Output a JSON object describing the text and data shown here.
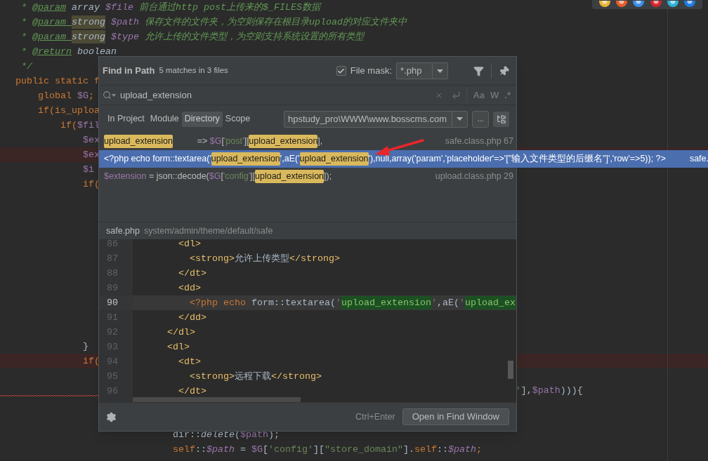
{
  "editor": {
    "lines": [
      {
        "marked": false,
        "underlined": false,
        "segments": [
          {
            "text": " * ",
            "kind": "comment"
          },
          {
            "text": "@param",
            "kind": "doc-tag"
          },
          {
            "text": " array ",
            "kind": "doc-type"
          },
          {
            "text": "$file",
            "kind": "doc-var"
          },
          {
            "text": " 前台通过http post上传来的$_FILES数据",
            "kind": "comment"
          }
        ]
      },
      {
        "marked": false,
        "underlined": false,
        "segments": [
          {
            "text": " * ",
            "kind": "comment"
          },
          {
            "text": "@param ",
            "kind": "doc-tag"
          },
          {
            "text": "strong",
            "kind": "doc-type-marked"
          },
          {
            "text": " $path",
            "kind": "doc-var"
          },
          {
            "text": " 保存文件的文件夹，为空则保存在根目录upload的对应文件夹中",
            "kind": "comment"
          }
        ]
      },
      {
        "marked": false,
        "underlined": false,
        "segments": [
          {
            "text": " * ",
            "kind": "comment"
          },
          {
            "text": "@param ",
            "kind": "doc-tag"
          },
          {
            "text": "strong",
            "kind": "doc-type-marked"
          },
          {
            "text": " $type",
            "kind": "doc-var"
          },
          {
            "text": " 允许上传的文件类型，为空则支持系统设置的所有类型",
            "kind": "comment"
          }
        ]
      },
      {
        "marked": false,
        "underlined": false,
        "segments": [
          {
            "text": " * ",
            "kind": "comment"
          },
          {
            "text": "@return",
            "kind": "doc-tag"
          },
          {
            "text": " boolean",
            "kind": "doc-type"
          }
        ]
      },
      {
        "marked": false,
        "underlined": false,
        "segments": [
          {
            "text": " */",
            "kind": "comment"
          }
        ]
      },
      {
        "marked": false,
        "underlined": false,
        "segments": [
          {
            "text": "public static f",
            "kind": "keyword"
          }
        ]
      },
      {
        "marked": false,
        "underlined": false,
        "segments": [
          {
            "text": "    global ",
            "kind": "keyword"
          },
          {
            "text": "$G",
            "kind": "var"
          },
          {
            "text": ";",
            "kind": "keyword"
          }
        ]
      },
      {
        "marked": false,
        "underlined": false,
        "segments": [
          {
            "text": "    if(is_uploa",
            "kind": "keyword"
          }
        ]
      },
      {
        "marked": false,
        "underlined": false,
        "segments": [
          {
            "text": "        if(",
            "kind": "keyword"
          },
          {
            "text": "$fil",
            "kind": "var"
          }
        ]
      },
      {
        "marked": false,
        "underlined": false,
        "segments": [
          {
            "text": "            $ex",
            "kind": "var"
          }
        ]
      },
      {
        "marked": true,
        "underlined": false,
        "segments": [
          {
            "text": "            $ex",
            "kind": "var"
          }
        ]
      },
      {
        "marked": false,
        "underlined": false,
        "segments": [
          {
            "text": "            $i",
            "kind": "var"
          }
        ]
      },
      {
        "marked": false,
        "underlined": false,
        "segments": [
          {
            "text": "            if(",
            "kind": "keyword"
          }
        ]
      },
      {
        "marked": false,
        "underlined": false
      },
      {
        "marked": false,
        "underlined": false
      },
      {
        "marked": false,
        "underlined": false
      },
      {
        "marked": false,
        "underlined": false
      },
      {
        "marked": false,
        "underlined": false
      },
      {
        "marked": false,
        "underlined": false
      },
      {
        "marked": false,
        "underlined": false
      },
      {
        "marked": false,
        "underlined": false
      },
      {
        "marked": false,
        "underlined": false
      },
      {
        "marked": false,
        "underlined": false
      },
      {
        "marked": false,
        "underlined": false,
        "segments": [
          {
            "text": "            }",
            "kind": "plain"
          }
        ]
      },
      {
        "marked": true,
        "underlined": false,
        "segments": [
          {
            "text": "            if(",
            "kind": "keyword"
          }
        ]
      },
      {
        "marked": false,
        "underlined": false
      },
      {
        "marked": false,
        "underlined": true,
        "segments": [
          {
            "text": "                                                                                         '",
            "kind": "string"
          },
          {
            "text": "],",
            "kind": "plain"
          },
          {
            "text": "$path",
            "kind": "var"
          },
          {
            "text": "))){",
            "kind": "plain"
          }
        ]
      },
      {
        "marked": false,
        "underlined": false
      },
      {
        "marked": false,
        "underlined": false
      },
      {
        "marked": false,
        "underlined": false,
        "segments": [
          {
            "text": "                            dir::",
            "kind": "plain"
          },
          {
            "text": "delete",
            "kind": "plain-italic"
          },
          {
            "text": "(",
            "kind": "plain"
          },
          {
            "text": "$path",
            "kind": "var"
          },
          {
            "text": ");",
            "kind": "plain"
          }
        ]
      },
      {
        "marked": false,
        "underlined": false,
        "segments": [
          {
            "text": "                            self",
            "kind": "keyword"
          },
          {
            "text": "::",
            "kind": "plain"
          },
          {
            "text": "$path",
            "kind": "var-italic"
          },
          {
            "text": " = ",
            "kind": "plain"
          },
          {
            "text": "$G",
            "kind": "var"
          },
          {
            "text": "[",
            "kind": "plain"
          },
          {
            "text": "'config'",
            "kind": "string"
          },
          {
            "text": "][",
            "kind": "plain"
          },
          {
            "text": "\"store_domain\"",
            "kind": "string"
          },
          {
            "text": "].",
            "kind": "plain"
          },
          {
            "text": "self",
            "kind": "keyword"
          },
          {
            "text": "::",
            "kind": "plain"
          },
          {
            "text": "$path",
            "kind": "var-italic"
          },
          {
            "text": ";",
            "kind": "keyword"
          }
        ]
      }
    ]
  },
  "find_dialog": {
    "title": "Find in Path",
    "summary": "5 matches in 3 files",
    "file_mask": {
      "label": "File mask:",
      "checked": true,
      "value": "*.php"
    },
    "search": {
      "value": "upload_extension"
    },
    "search_options": [
      "Aa",
      "W",
      ".*"
    ],
    "scopes": [
      {
        "label": "In Project",
        "selected": false
      },
      {
        "label": "Module",
        "selected": false
      },
      {
        "label": "Directory",
        "selected": true
      },
      {
        "label": "Scope",
        "selected": false
      }
    ],
    "directory": {
      "value": "hpstudy_pro\\WWW\\www.bosscms.com"
    },
    "browse_button": "...",
    "results": [
      {
        "selected": false,
        "file": "safe.class.php 67",
        "segments": [
          {
            "text": "upload_extension",
            "kind": "match"
          },
          {
            "text": "          => ",
            "kind": "plain"
          },
          {
            "text": "$G",
            "kind": "var"
          },
          {
            "text": "[",
            "kind": "plain"
          },
          {
            "text": "'post'",
            "kind": "string"
          },
          {
            "text": "][",
            "kind": "plain"
          },
          {
            "text": "upload_extension",
            "kind": "match"
          },
          {
            "text": "],",
            "kind": "plain"
          }
        ]
      },
      {
        "selected": true,
        "file": "safe.",
        "segments": [
          {
            "text": "<?php echo form::textarea('",
            "kind": "plain"
          },
          {
            "text": "upload_extension",
            "kind": "match"
          },
          {
            "text": "',aE('",
            "kind": "plain"
          },
          {
            "text": "upload_extension",
            "kind": "match"
          },
          {
            "text": "'),null,array('param','placeholder'=>'[\"输入文件类型的后缀名\"]','row'=>5)); ?>",
            "kind": "plain"
          }
        ]
      },
      {
        "selected": false,
        "file": "upload.class.php 29",
        "segments": [
          {
            "text": "$extension",
            "kind": "var"
          },
          {
            "text": " = json::decode(",
            "kind": "plain"
          },
          {
            "text": "$G",
            "kind": "var"
          },
          {
            "text": "[",
            "kind": "plain"
          },
          {
            "text": "'config'",
            "kind": "string"
          },
          {
            "text": "][",
            "kind": "plain"
          },
          {
            "text": "upload_extension",
            "kind": "match"
          },
          {
            "text": "]);",
            "kind": "plain"
          }
        ]
      }
    ],
    "preview": {
      "file": "safe.php",
      "path": "system/admin/theme/default/safe",
      "lines": [
        {
          "number": "86",
          "current": false,
          "segments": [
            {
              "text": "       <dl>",
              "kind": "tag"
            }
          ]
        },
        {
          "number": "87",
          "current": false,
          "segments": [
            {
              "text": "         <strong>",
              "kind": "tag"
            },
            {
              "text": "允许上传类型",
              "kind": "plain"
            },
            {
              "text": "</strong>",
              "kind": "tag"
            }
          ]
        },
        {
          "number": "88",
          "current": false,
          "segments": [
            {
              "text": "       </dt>",
              "kind": "tag"
            }
          ]
        },
        {
          "number": "89",
          "current": false,
          "segments": [
            {
              "text": "       <dd>",
              "kind": "tag"
            }
          ]
        },
        {
          "number": "90",
          "current": true,
          "segments": [
            {
              "text": "         <?php echo",
              "kind": "keyword"
            },
            {
              "text": " form::textarea(",
              "kind": "plain"
            },
            {
              "text": "'",
              "kind": "string"
            },
            {
              "text": "upload_extension",
              "kind": "string-match"
            },
            {
              "text": "'",
              "kind": "string"
            },
            {
              "text": ",aE(",
              "kind": "plain"
            },
            {
              "text": "'",
              "kind": "string"
            },
            {
              "text": "upload_ex",
              "kind": "string-match"
            }
          ]
        },
        {
          "number": "91",
          "current": false,
          "segments": [
            {
              "text": "       </dd>",
              "kind": "tag"
            }
          ]
        },
        {
          "number": "92",
          "current": false,
          "segments": [
            {
              "text": "     </dl>",
              "kind": "tag"
            }
          ]
        },
        {
          "number": "93",
          "current": false,
          "segments": [
            {
              "text": "     <dl>",
              "kind": "tag"
            }
          ]
        },
        {
          "number": "94",
          "current": false,
          "segments": [
            {
              "text": "       <dt>",
              "kind": "tag"
            }
          ]
        },
        {
          "number": "95",
          "current": false,
          "segments": [
            {
              "text": "         <strong>",
              "kind": "tag"
            },
            {
              "text": "远程下载",
              "kind": "plain"
            },
            {
              "text": "</strong>",
              "kind": "tag"
            }
          ]
        },
        {
          "number": "96",
          "current": false,
          "segments": [
            {
              "text": "       </dt>",
              "kind": "tag"
            }
          ]
        }
      ]
    },
    "shortcut": "Ctrl+Enter",
    "open_button": "Open in Find Window"
  }
}
